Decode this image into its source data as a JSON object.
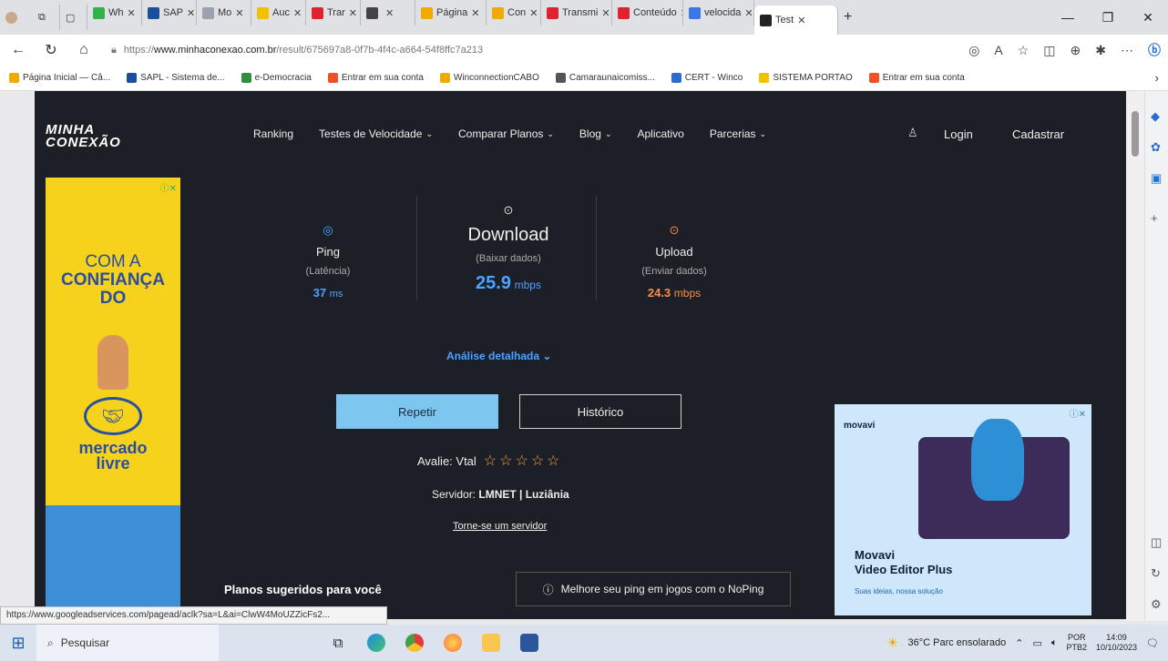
{
  "tabs": [
    {
      "label": "Wh",
      "color": "#2fb34a"
    },
    {
      "label": "SAP",
      "color": "#1a4fa0"
    },
    {
      "label": "Mo",
      "color": "#9aa3ad"
    },
    {
      "label": "Auc",
      "color": "#f2c200"
    },
    {
      "label": "Trar",
      "color": "#e0212e"
    },
    {
      "label": "",
      "color": "#444"
    },
    {
      "label": "Página",
      "color": "#f2a900"
    },
    {
      "label": "Con",
      "color": "#f2a900"
    },
    {
      "label": "Transmi",
      "color": "#e0212e"
    },
    {
      "label": "Conteúdo",
      "color": "#e0212e"
    },
    {
      "label": "velocida",
      "color": "#3b78e7"
    },
    {
      "label": "Test",
      "color": "#222"
    }
  ],
  "address": {
    "scheme": "https://",
    "host": "www.minhaconexao.com.br",
    "path": "/result/675697a8-0f7b-4f4c-a664-54f8ffc7a213"
  },
  "bookmarks": [
    {
      "label": "Página Inicial — Câ...",
      "color": "#f2a900"
    },
    {
      "label": "SAPL - Sistema de...",
      "color": "#1a4fa0"
    },
    {
      "label": "e-Democracia",
      "color": "#2f8f3a"
    },
    {
      "label": "Entrar em sua conta",
      "color": "#f25022"
    },
    {
      "label": "WinconnectionCABO",
      "color": "#f2a900"
    },
    {
      "label": "Camaraunaicomiss...",
      "color": "#555"
    },
    {
      "label": "CERT - Winco",
      "color": "#2a6bd1"
    },
    {
      "label": "SISTEMA PORTAO",
      "color": "#f2c200"
    },
    {
      "label": "Entrar em sua conta",
      "color": "#f25022"
    }
  ],
  "site": {
    "logo_top": "MINHA",
    "logo_bottom": "CONEXÃO",
    "nav": [
      {
        "label": "Ranking",
        "dropdown": false
      },
      {
        "label": "Testes de Velocidade",
        "dropdown": true
      },
      {
        "label": "Comparar Planos",
        "dropdown": true
      },
      {
        "label": "Blog",
        "dropdown": true
      },
      {
        "label": "Aplicativo",
        "dropdown": false
      },
      {
        "label": "Parcerias",
        "dropdown": true
      }
    ],
    "login": "Login",
    "signup": "Cadastrar"
  },
  "result": {
    "ping": {
      "title": "Ping",
      "sub": "(Latência)",
      "value": "37",
      "unit": "ms",
      "color": "#4aa3ff"
    },
    "download": {
      "title": "Download",
      "sub": "(Baixar dados)",
      "value": "25.9",
      "unit": "mbps",
      "color": "#4aa3ff"
    },
    "upload": {
      "title": "Upload",
      "sub": "(Enviar dados)",
      "value": "24.3",
      "unit": "mbps",
      "color": "#ff8a4a"
    },
    "detail": "Análise detalhada",
    "repeat": "Repetir",
    "history": "Histórico",
    "rate_label": "Avalie: Vtal",
    "stars": "☆☆☆☆☆",
    "server_label": "Servidor:",
    "server_name": "LMNET | Luziânia",
    "become_server": "Torne-se um servidor"
  },
  "plans_title": "Planos sugeridos para você",
  "noping": "Melhore seu ping em jogos com o NoPing",
  "ad_left": {
    "line1": "COM A",
    "line2": "CONFIANÇA",
    "line3": "DO",
    "brand1": "mercado",
    "brand2": "livre"
  },
  "ad_right": {
    "brand": "movavi",
    "title1": "Movavi",
    "title2": "Video Editor Plus",
    "tagline": "Suas ideias, nossa solução"
  },
  "status_url": "https://www.googleadservices.com/pagead/aclk?sa=L&ai=ClwW4MoUZZicFs2...",
  "taskbar": {
    "search": "Pesquisar",
    "weather": "36°C  Parc ensolarado",
    "lang1": "POR",
    "lang2": "PTB2",
    "time": "14:09",
    "date": "10/10/2023"
  }
}
